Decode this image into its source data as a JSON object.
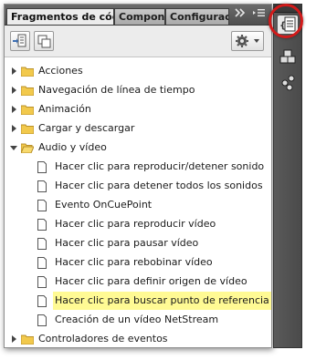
{
  "tabs": [
    {
      "label": "Fragmentos de código",
      "active": true
    },
    {
      "label": "Componen",
      "active": false
    },
    {
      "label": "Configurac",
      "active": false
    }
  ],
  "tab_overflow_icon": "double-chevron-right",
  "tab_menu_icon": "panel-menu",
  "toolbar": {
    "icons": [
      "insert-snippet-icon",
      "copy-snippet-icon",
      "gear-icon"
    ]
  },
  "tree": [
    {
      "label": "Acciones",
      "type": "folder",
      "expanded": false
    },
    {
      "label": "Navegación de línea de tiempo",
      "type": "folder",
      "expanded": false
    },
    {
      "label": "Animación",
      "type": "folder",
      "expanded": false
    },
    {
      "label": "Cargar y descargar",
      "type": "folder",
      "expanded": false
    },
    {
      "label": "Audio y vídeo",
      "type": "folder",
      "expanded": true
    },
    {
      "label": "Hacer clic para reproducir/detener sonido",
      "type": "doc"
    },
    {
      "label": "Hacer clic para detener todos los sonidos",
      "type": "doc"
    },
    {
      "label": "Evento OnCuePoint",
      "type": "doc"
    },
    {
      "label": "Hacer clic para reproducir vídeo",
      "type": "doc"
    },
    {
      "label": "Hacer clic para pausar vídeo",
      "type": "doc"
    },
    {
      "label": "Hacer clic para rebobinar vídeo",
      "type": "doc"
    },
    {
      "label": "Hacer clic para definir origen de vídeo",
      "type": "doc"
    },
    {
      "label": "Hacer clic para buscar punto de referencia",
      "type": "doc",
      "highlighted": true
    },
    {
      "label": "Creación de un vídeo NetStream",
      "type": "doc"
    },
    {
      "label": "Controladores de eventos",
      "type": "folder",
      "expanded": false
    }
  ],
  "colors": {
    "highlight": "#fffa94",
    "folder": "#f2c94c",
    "annotation": "#d21a1a"
  },
  "dock_icons": [
    "code-snippets-icon",
    "components-icon",
    "settings-icon"
  ]
}
